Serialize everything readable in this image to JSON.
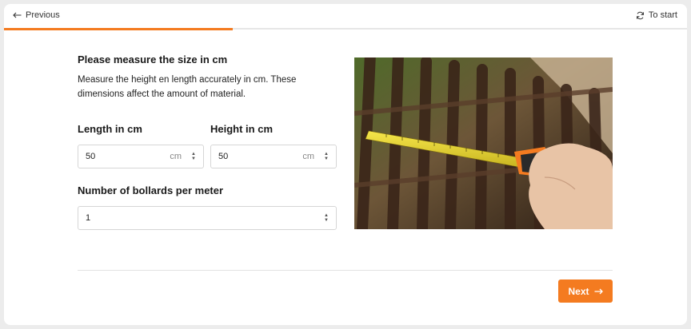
{
  "nav": {
    "previous_label": "Previous",
    "to_start_label": "To start",
    "progress_percent": 33.5
  },
  "form": {
    "title": "Please measure the size in cm",
    "description": "Measure the height en length accurately in cm. These dimensions affect the amount of material.",
    "length": {
      "label": "Length in cm",
      "value": "50",
      "unit": "cm"
    },
    "height": {
      "label": "Height in cm",
      "value": "50",
      "unit": "cm"
    },
    "bollards": {
      "label": "Number of bollards per meter",
      "value": "1"
    }
  },
  "next_label": "Next",
  "colors": {
    "accent": "#f47b20"
  },
  "icons": {
    "previous": "arrow-left-icon",
    "to_start": "refresh-icon",
    "next": "arrow-right-icon",
    "stepper": "stepper-icon"
  }
}
